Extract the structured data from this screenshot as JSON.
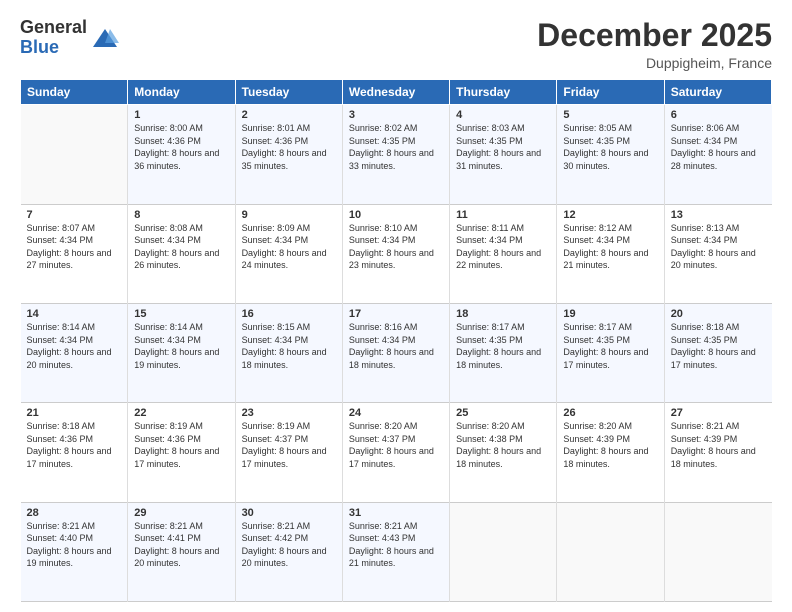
{
  "logo": {
    "general": "General",
    "blue": "Blue"
  },
  "title": "December 2025",
  "location": "Duppigheim, France",
  "days_of_week": [
    "Sunday",
    "Monday",
    "Tuesday",
    "Wednesday",
    "Thursday",
    "Friday",
    "Saturday"
  ],
  "weeks": [
    [
      {
        "day": "",
        "sunrise": "",
        "sunset": "",
        "daylight": ""
      },
      {
        "day": "1",
        "sunrise": "Sunrise: 8:00 AM",
        "sunset": "Sunset: 4:36 PM",
        "daylight": "Daylight: 8 hours and 36 minutes."
      },
      {
        "day": "2",
        "sunrise": "Sunrise: 8:01 AM",
        "sunset": "Sunset: 4:36 PM",
        "daylight": "Daylight: 8 hours and 35 minutes."
      },
      {
        "day": "3",
        "sunrise": "Sunrise: 8:02 AM",
        "sunset": "Sunset: 4:35 PM",
        "daylight": "Daylight: 8 hours and 33 minutes."
      },
      {
        "day": "4",
        "sunrise": "Sunrise: 8:03 AM",
        "sunset": "Sunset: 4:35 PM",
        "daylight": "Daylight: 8 hours and 31 minutes."
      },
      {
        "day": "5",
        "sunrise": "Sunrise: 8:05 AM",
        "sunset": "Sunset: 4:35 PM",
        "daylight": "Daylight: 8 hours and 30 minutes."
      },
      {
        "day": "6",
        "sunrise": "Sunrise: 8:06 AM",
        "sunset": "Sunset: 4:34 PM",
        "daylight": "Daylight: 8 hours and 28 minutes."
      }
    ],
    [
      {
        "day": "7",
        "sunrise": "Sunrise: 8:07 AM",
        "sunset": "Sunset: 4:34 PM",
        "daylight": "Daylight: 8 hours and 27 minutes."
      },
      {
        "day": "8",
        "sunrise": "Sunrise: 8:08 AM",
        "sunset": "Sunset: 4:34 PM",
        "daylight": "Daylight: 8 hours and 26 minutes."
      },
      {
        "day": "9",
        "sunrise": "Sunrise: 8:09 AM",
        "sunset": "Sunset: 4:34 PM",
        "daylight": "Daylight: 8 hours and 24 minutes."
      },
      {
        "day": "10",
        "sunrise": "Sunrise: 8:10 AM",
        "sunset": "Sunset: 4:34 PM",
        "daylight": "Daylight: 8 hours and 23 minutes."
      },
      {
        "day": "11",
        "sunrise": "Sunrise: 8:11 AM",
        "sunset": "Sunset: 4:34 PM",
        "daylight": "Daylight: 8 hours and 22 minutes."
      },
      {
        "day": "12",
        "sunrise": "Sunrise: 8:12 AM",
        "sunset": "Sunset: 4:34 PM",
        "daylight": "Daylight: 8 hours and 21 minutes."
      },
      {
        "day": "13",
        "sunrise": "Sunrise: 8:13 AM",
        "sunset": "Sunset: 4:34 PM",
        "daylight": "Daylight: 8 hours and 20 minutes."
      }
    ],
    [
      {
        "day": "14",
        "sunrise": "Sunrise: 8:14 AM",
        "sunset": "Sunset: 4:34 PM",
        "daylight": "Daylight: 8 hours and 20 minutes."
      },
      {
        "day": "15",
        "sunrise": "Sunrise: 8:14 AM",
        "sunset": "Sunset: 4:34 PM",
        "daylight": "Daylight: 8 hours and 19 minutes."
      },
      {
        "day": "16",
        "sunrise": "Sunrise: 8:15 AM",
        "sunset": "Sunset: 4:34 PM",
        "daylight": "Daylight: 8 hours and 18 minutes."
      },
      {
        "day": "17",
        "sunrise": "Sunrise: 8:16 AM",
        "sunset": "Sunset: 4:34 PM",
        "daylight": "Daylight: 8 hours and 18 minutes."
      },
      {
        "day": "18",
        "sunrise": "Sunrise: 8:17 AM",
        "sunset": "Sunset: 4:35 PM",
        "daylight": "Daylight: 8 hours and 18 minutes."
      },
      {
        "day": "19",
        "sunrise": "Sunrise: 8:17 AM",
        "sunset": "Sunset: 4:35 PM",
        "daylight": "Daylight: 8 hours and 17 minutes."
      },
      {
        "day": "20",
        "sunrise": "Sunrise: 8:18 AM",
        "sunset": "Sunset: 4:35 PM",
        "daylight": "Daylight: 8 hours and 17 minutes."
      }
    ],
    [
      {
        "day": "21",
        "sunrise": "Sunrise: 8:18 AM",
        "sunset": "Sunset: 4:36 PM",
        "daylight": "Daylight: 8 hours and 17 minutes."
      },
      {
        "day": "22",
        "sunrise": "Sunrise: 8:19 AM",
        "sunset": "Sunset: 4:36 PM",
        "daylight": "Daylight: 8 hours and 17 minutes."
      },
      {
        "day": "23",
        "sunrise": "Sunrise: 8:19 AM",
        "sunset": "Sunset: 4:37 PM",
        "daylight": "Daylight: 8 hours and 17 minutes."
      },
      {
        "day": "24",
        "sunrise": "Sunrise: 8:20 AM",
        "sunset": "Sunset: 4:37 PM",
        "daylight": "Daylight: 8 hours and 17 minutes."
      },
      {
        "day": "25",
        "sunrise": "Sunrise: 8:20 AM",
        "sunset": "Sunset: 4:38 PM",
        "daylight": "Daylight: 8 hours and 18 minutes."
      },
      {
        "day": "26",
        "sunrise": "Sunrise: 8:20 AM",
        "sunset": "Sunset: 4:39 PM",
        "daylight": "Daylight: 8 hours and 18 minutes."
      },
      {
        "day": "27",
        "sunrise": "Sunrise: 8:21 AM",
        "sunset": "Sunset: 4:39 PM",
        "daylight": "Daylight: 8 hours and 18 minutes."
      }
    ],
    [
      {
        "day": "28",
        "sunrise": "Sunrise: 8:21 AM",
        "sunset": "Sunset: 4:40 PM",
        "daylight": "Daylight: 8 hours and 19 minutes."
      },
      {
        "day": "29",
        "sunrise": "Sunrise: 8:21 AM",
        "sunset": "Sunset: 4:41 PM",
        "daylight": "Daylight: 8 hours and 20 minutes."
      },
      {
        "day": "30",
        "sunrise": "Sunrise: 8:21 AM",
        "sunset": "Sunset: 4:42 PM",
        "daylight": "Daylight: 8 hours and 20 minutes."
      },
      {
        "day": "31",
        "sunrise": "Sunrise: 8:21 AM",
        "sunset": "Sunset: 4:43 PM",
        "daylight": "Daylight: 8 hours and 21 minutes."
      },
      {
        "day": "",
        "sunrise": "",
        "sunset": "",
        "daylight": ""
      },
      {
        "day": "",
        "sunrise": "",
        "sunset": "",
        "daylight": ""
      },
      {
        "day": "",
        "sunrise": "",
        "sunset": "",
        "daylight": ""
      }
    ]
  ]
}
